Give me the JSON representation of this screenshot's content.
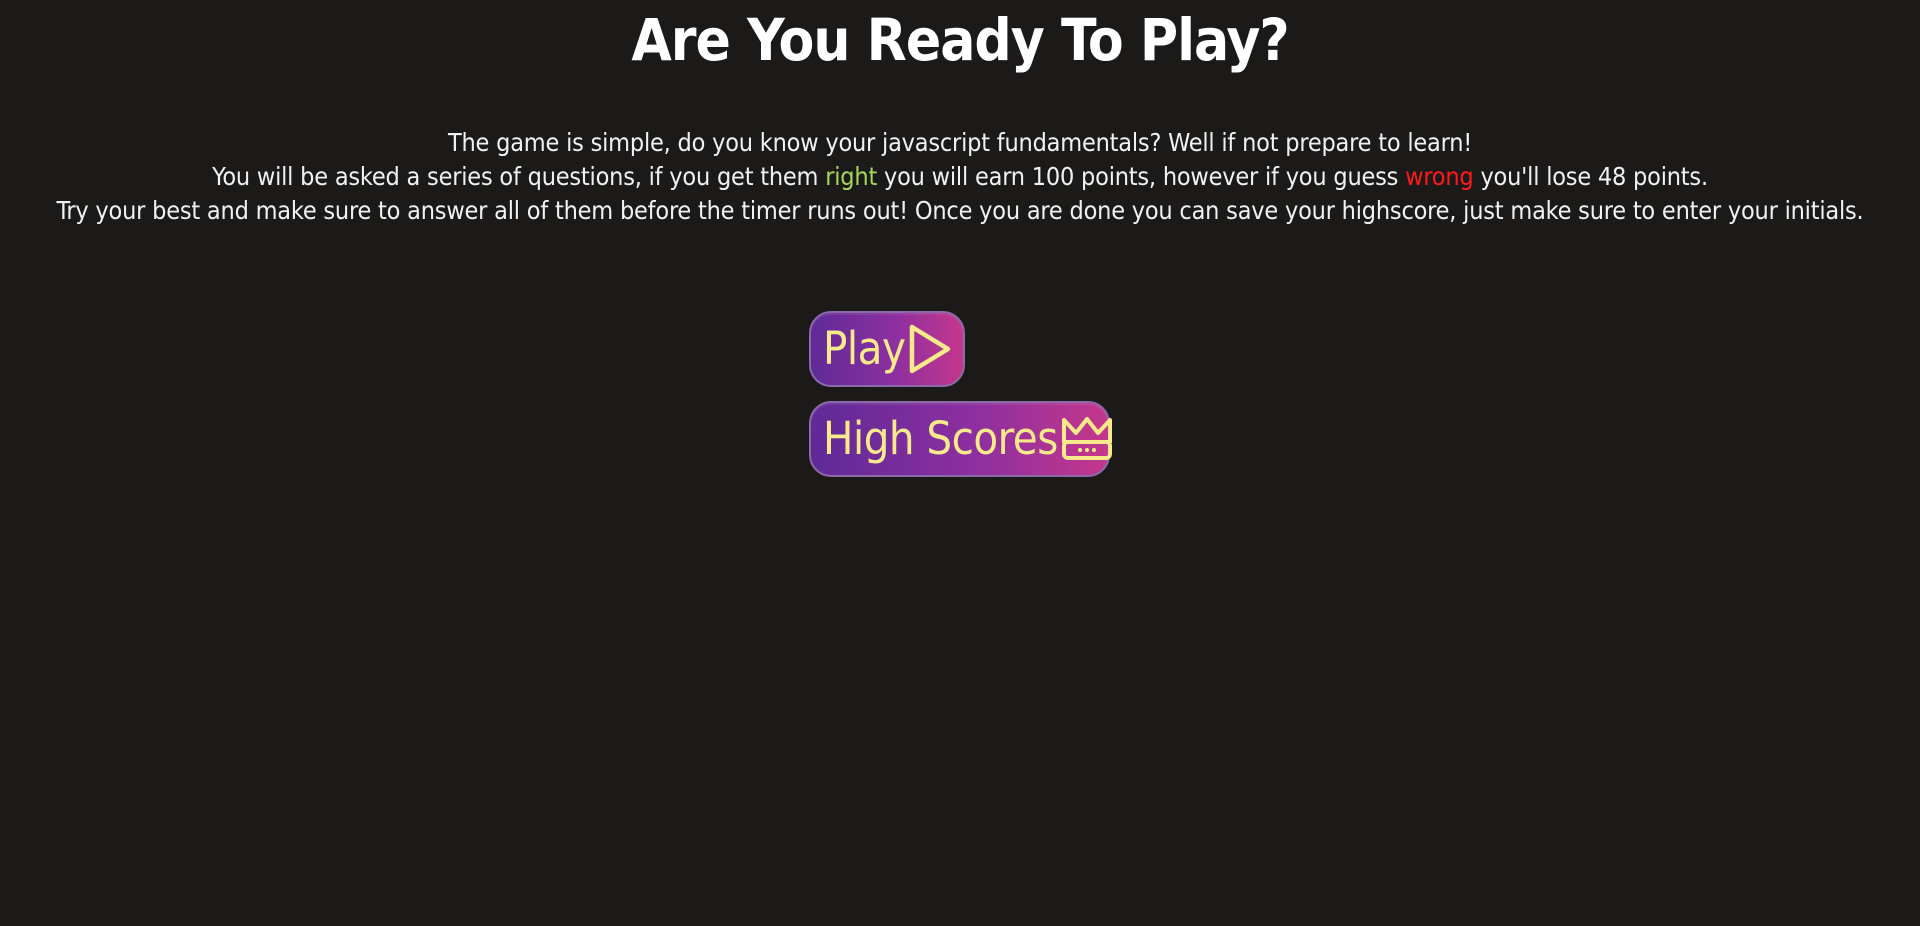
{
  "heading": "Are You Ready To Play?",
  "instructions": {
    "line1": "The game is simple, do you know your javascript fundamentals? Well if not prepare to learn!",
    "line2_part1": "You will be asked a series of questions, if you get them ",
    "line2_right": "right",
    "line2_part2": " you will earn 100 points, however if you guess ",
    "line2_wrong": "wrong",
    "line2_part3": " you'll lose 48 points.",
    "line3": "Try your best and make sure to answer all of them before the timer runs out! Once you are done you can save your highscore, just make sure to enter your initials."
  },
  "buttons": {
    "play_label": "Play",
    "play_icon": "play-icon",
    "high_scores_label": "High Scores",
    "high_scores_icon": "crown-icon"
  },
  "colors": {
    "background": "#1b1a19",
    "right_highlight": "#a6d65a",
    "wrong_highlight": "#ff1a1a",
    "button_text": "#f8e98a",
    "button_gradient_start": "#5f2a97",
    "button_gradient_end": "#c4378c"
  }
}
